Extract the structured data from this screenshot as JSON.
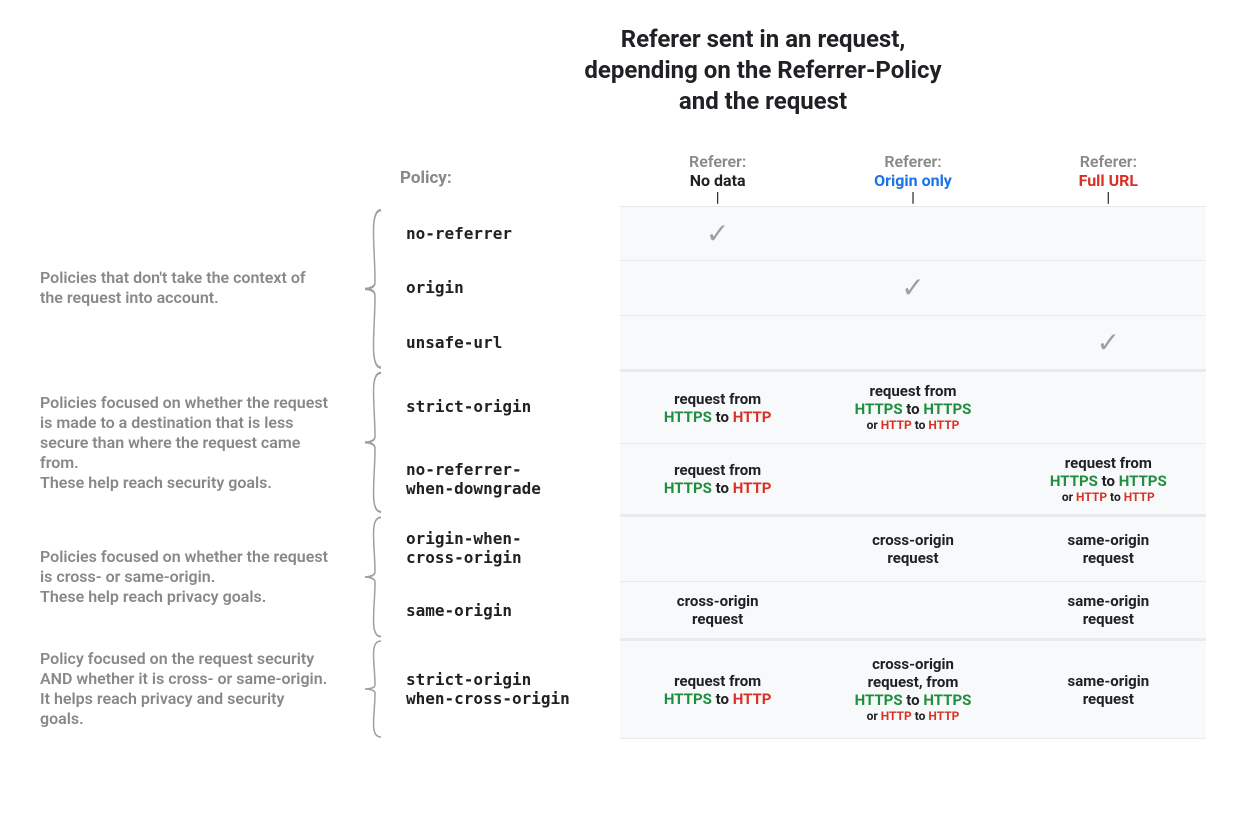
{
  "title": "Referer sent in an request, depending on the Referrer-Policy and the request",
  "columns": {
    "policy_label": "Policy:",
    "c1_top": "Referer:",
    "c1_bot": "No data",
    "c2_top": "Referer:",
    "c2_bot": "Origin only",
    "c3_top": "Referer:",
    "c3_bot": "Full URL"
  },
  "groups": [
    {
      "desc": "Policies that don't take the context of the request into account.",
      "rows": [
        {
          "policy": "no-referrer",
          "c1": {
            "check": true
          },
          "c2": {},
          "c3": {}
        },
        {
          "policy": "origin",
          "c1": {},
          "c2": {
            "check": true
          },
          "c3": {}
        },
        {
          "policy": "unsafe-url",
          "c1": {},
          "c2": {},
          "c3": {
            "check": true
          }
        }
      ]
    },
    {
      "desc": "Policies focused on whether the request is made to a destination that is less secure than where the request came from.\nThese help reach security goals.",
      "rows": [
        {
          "policy": "strict-origin",
          "c1": {
            "rich": "request from\n{HTTPS} to {HTTP}"
          },
          "c2": {
            "rich": "request from\n{HTTPS} to {HTTPS}",
            "sub": "or {HTTP} to {HTTP}"
          },
          "c3": {}
        },
        {
          "policy": "no-referrer-\nwhen-downgrade",
          "c1": {
            "rich": "request from\n{HTTPS} to {HTTP}"
          },
          "c2": {},
          "c3": {
            "rich": "request from\n{HTTPS} to {HTTPS}",
            "sub": "or {HTTP} to {HTTP}"
          }
        }
      ]
    },
    {
      "desc": "Policies focused on whether the request is cross- or same-origin.\nThese help reach privacy goals.",
      "rows": [
        {
          "policy": "origin-when-\ncross-origin",
          "c1": {},
          "c2": {
            "text": "cross-origin\nrequest"
          },
          "c3": {
            "text": "same-origin\nrequest"
          }
        },
        {
          "policy": "same-origin",
          "c1": {
            "text": "cross-origin\nrequest"
          },
          "c2": {},
          "c3": {
            "text": "same-origin\nrequest"
          }
        }
      ]
    },
    {
      "desc": "Policy focused on the request security AND whether it is cross- or same-origin.\nIt helps reach privacy and security goals.",
      "rows": [
        {
          "policy": "strict-origin\nwhen-cross-origin",
          "c1": {
            "rich": "request from\n{HTTPS} to {HTTP}"
          },
          "c2": {
            "rich": "cross-origin\nrequest, from\n{HTTPS} to {HTTPS}",
            "sub": "or {HTTP} to {HTTP}"
          },
          "c3": {
            "text": "same-origin\nrequest"
          }
        }
      ]
    }
  ]
}
